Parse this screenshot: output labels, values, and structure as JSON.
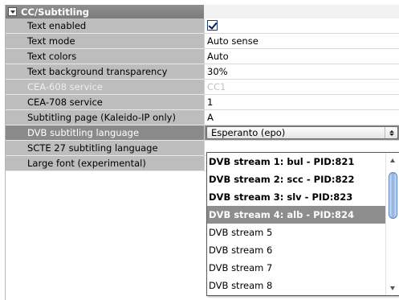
{
  "section": {
    "title": "CC/Subtitling"
  },
  "rows": [
    {
      "label": "Text enabled",
      "value": "",
      "type": "checkbox",
      "checked": true
    },
    {
      "label": "Text mode",
      "value": "Auto sense",
      "type": "text"
    },
    {
      "label": "Text colors",
      "value": "Auto",
      "type": "text"
    },
    {
      "label": "Text background transparency",
      "value": "30%",
      "type": "text"
    },
    {
      "label": "CEA-608 service",
      "value": "CC1",
      "type": "text",
      "disabled": true
    },
    {
      "label": "CEA-708 service",
      "value": "1",
      "type": "text"
    },
    {
      "label": "Subtitling page (Kaleido-IP only)",
      "value": "A",
      "type": "text"
    },
    {
      "label": "DVB subtitling language",
      "value": "Esperanto (epo)",
      "type": "combo",
      "selected": true
    },
    {
      "label": "SCTE 27 subtitling language",
      "value": "",
      "type": "text"
    },
    {
      "label": "Large font (experimental)",
      "value": "",
      "type": "text"
    }
  ],
  "dropdown": {
    "items": [
      {
        "label": "DVB stream 1: bul - PID:821",
        "bold": true
      },
      {
        "label": "DVB stream 2: scc - PID:822",
        "bold": true
      },
      {
        "label": "DVB stream 3: slv - PID:823",
        "bold": true
      },
      {
        "label": "DVB stream 4: alb - PID:824",
        "bold": true,
        "highlighted": true
      },
      {
        "label": "DVB stream 5"
      },
      {
        "label": "DVB stream 6"
      },
      {
        "label": "DVB stream 7"
      },
      {
        "label": "DVB stream 8"
      }
    ]
  },
  "colors": {
    "label_bg": "#bdbdbd",
    "selected_bg": "#8a8a8a",
    "header_bg": "#858585",
    "highlight_bg": "#8d8d8d"
  }
}
